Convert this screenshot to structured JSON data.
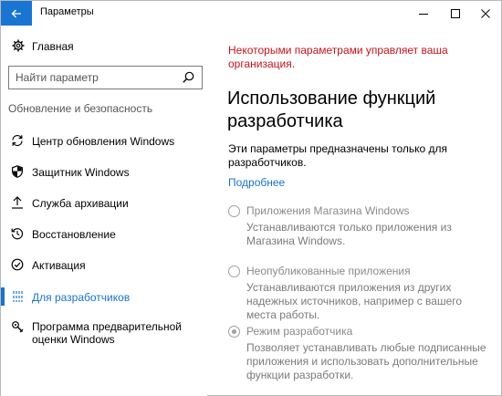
{
  "titlebar": {
    "title": "Параметры",
    "back_icon": "back-arrow-icon",
    "back_color": "#1a75d2"
  },
  "sidebar": {
    "home_label": "Главная",
    "search_placeholder": "Найти параметр",
    "section_title": "Обновление и безопасность",
    "items": [
      {
        "label": "Центр обновления Windows",
        "icon": "refresh-icon",
        "active": false
      },
      {
        "label": "Защитник Windows",
        "icon": "shield-icon",
        "active": false
      },
      {
        "label": "Служба архивации",
        "icon": "upload-arrow-icon",
        "active": false
      },
      {
        "label": "Восстановление",
        "icon": "history-icon",
        "active": false
      },
      {
        "label": "Активация",
        "icon": "check-circle-icon",
        "active": false
      },
      {
        "label": "Для разработчиков",
        "icon": "developer-tools-icon",
        "active": true
      },
      {
        "label": "Программа предварительной оценки Windows",
        "icon": "insider-icon",
        "active": false
      }
    ]
  },
  "main": {
    "policy_warning": "Некоторыми параметрами управляет ваша организация.",
    "title": "Использование функций разработчика",
    "description": "Эти параметры предназначены только для разработчиков.",
    "learn_more": "Подробнее",
    "options": [
      {
        "label": "Приложения Магазина Windows",
        "description": "Устанавливаются только приложения из Магазина Windows.",
        "selected": false
      },
      {
        "label": "Неопубликованные приложения",
        "description": "Устанавливаются приложения из других надежных источников, например с вашего места работы.",
        "selected": false
      },
      {
        "label": "Режим разработчика",
        "description": "Позволяет устанавливать любые подписанные приложения и использовать дополнительные функции разработки.",
        "selected": true
      }
    ]
  },
  "colors": {
    "accent": "#1a73c8",
    "warning": "#c4131b",
    "disabled_text": "#8a8a8a"
  }
}
